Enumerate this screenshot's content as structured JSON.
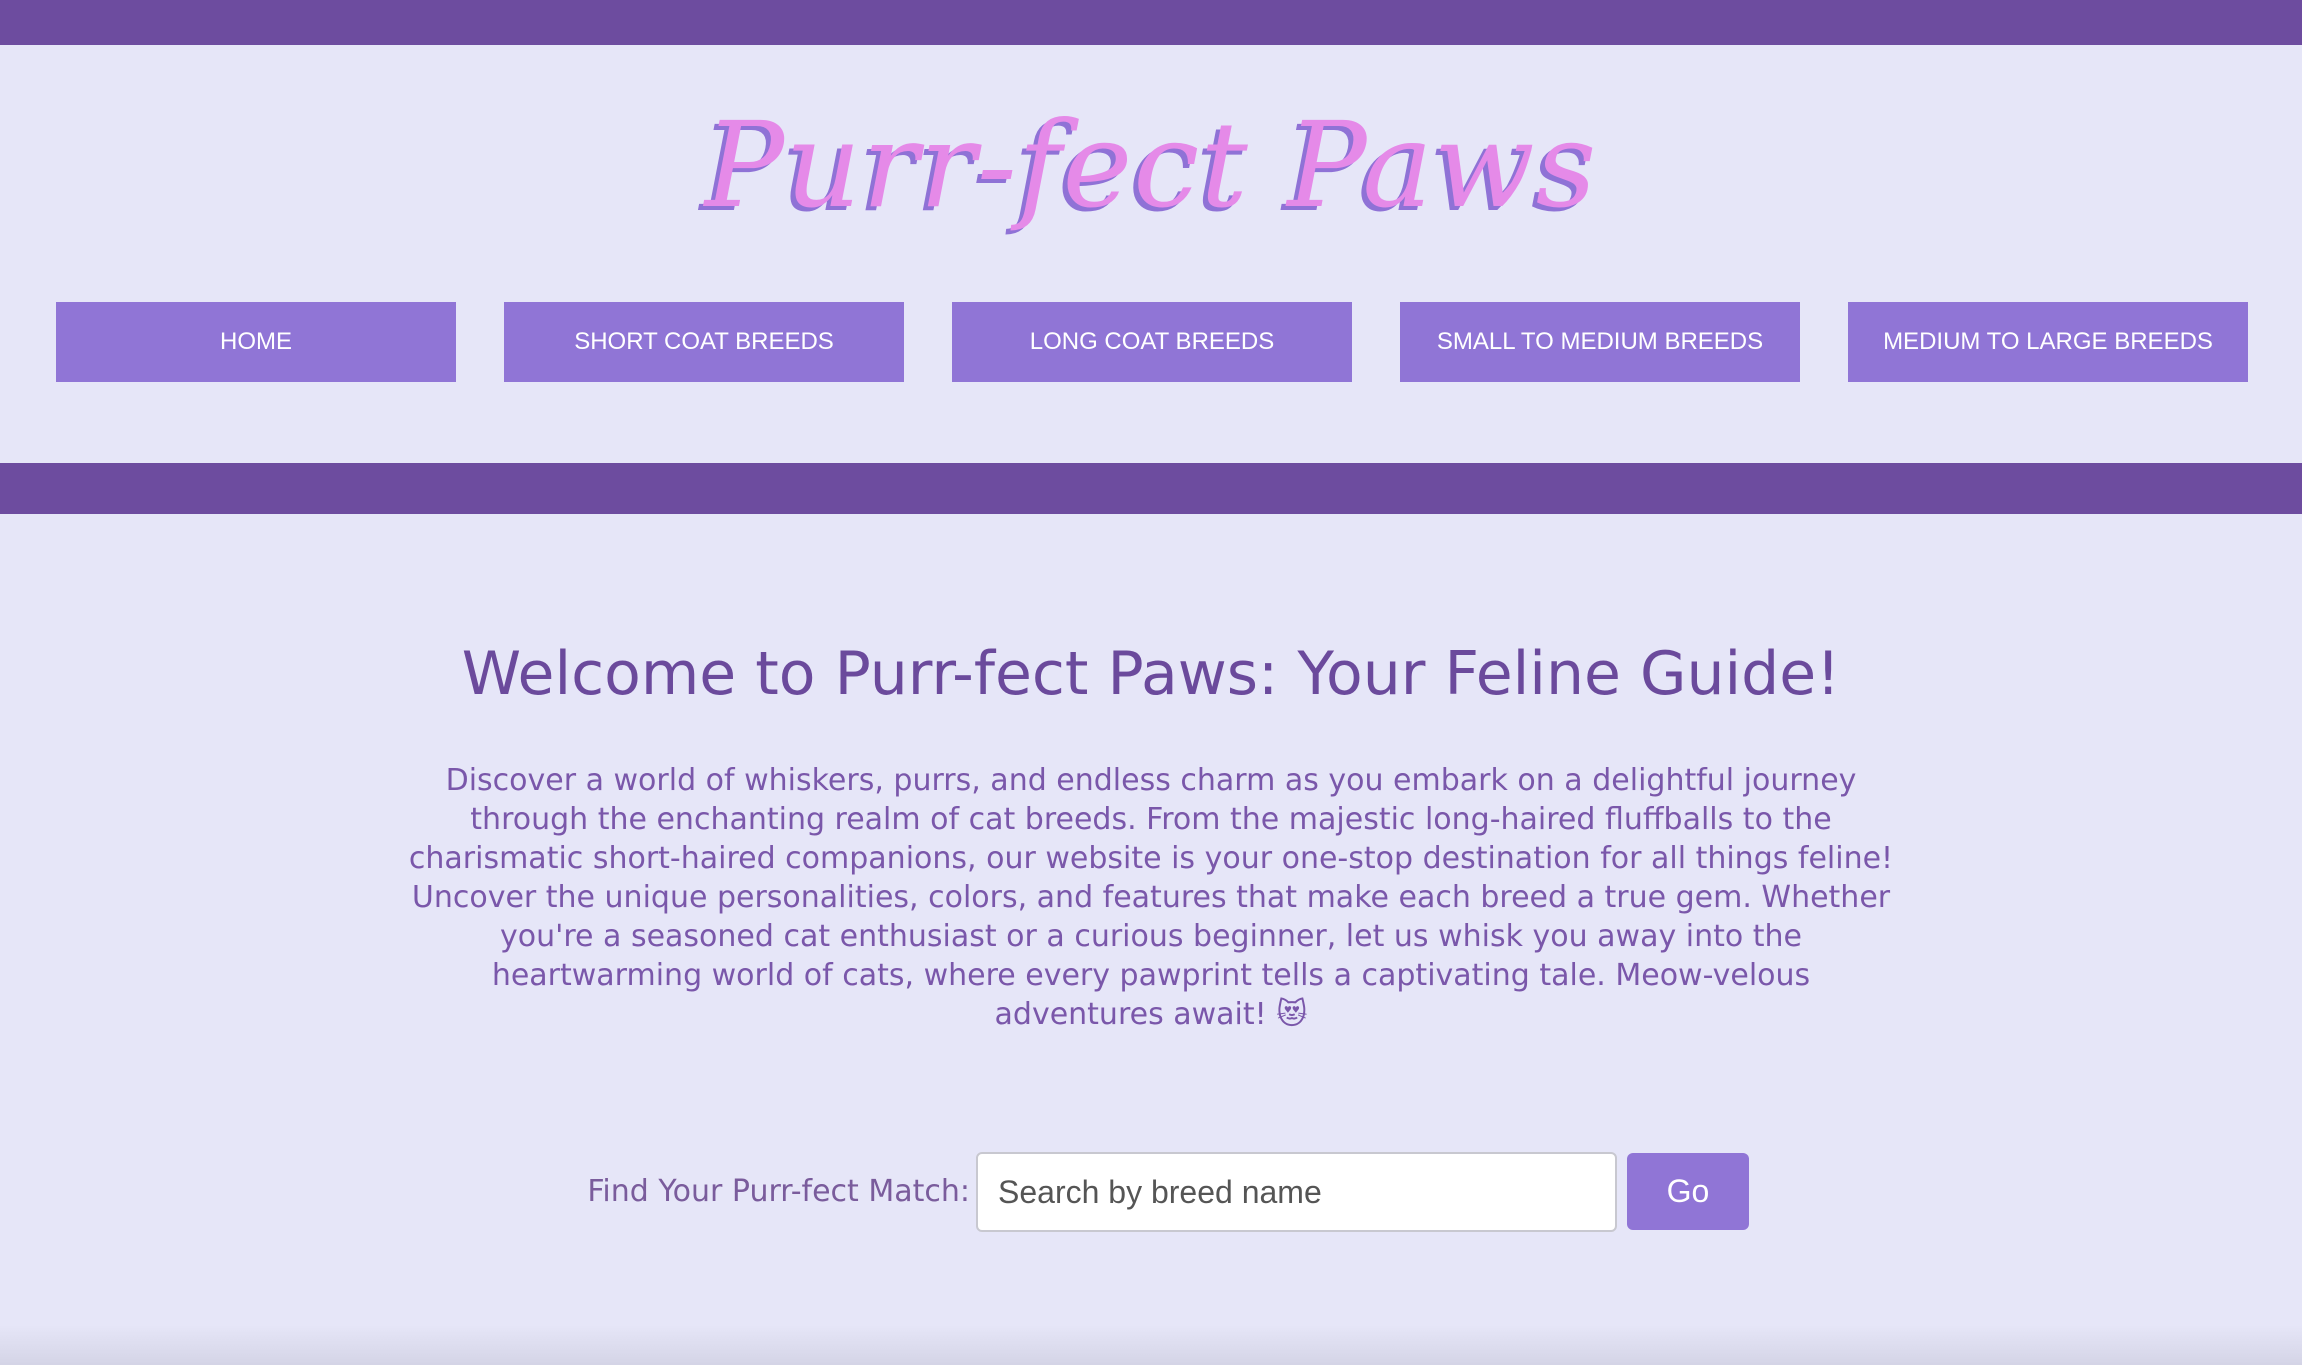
{
  "header": {
    "logo_text": "Purr-fect Paws"
  },
  "nav": {
    "items": [
      {
        "label": "HOME"
      },
      {
        "label": "SHORT COAT BREEDS"
      },
      {
        "label": "LONG COAT BREEDS"
      },
      {
        "label": "SMALL TO MEDIUM BREEDS"
      },
      {
        "label": "MEDIUM TO LARGE BREEDS"
      }
    ]
  },
  "main": {
    "title": "Welcome to Purr-fect Paws: Your Feline Guide!",
    "intro": "Discover a world of whiskers, purrs, and endless charm as you embark on a delightful journey through the enchanting realm of cat breeds. From the majestic long-haired fluffballs to the charismatic short-haired companions, our website is your one-stop destination for all things feline! Uncover the unique personalities, colors, and features that make each breed a true gem. Whether you're a seasoned cat enthusiast or a curious beginner, let us whisk you away into the heartwarming world of cats, where every pawprint tells a captivating tale. Meow-velous adventures await! 😻"
  },
  "search": {
    "label": "Find Your Purr-fect Match:",
    "placeholder": "Search by breed name",
    "value": "",
    "button_label": "Go"
  },
  "colors": {
    "background": "#e6e6f8",
    "bar": "#6d4c9f",
    "button": "#9075d6",
    "logo": "#e58ae8",
    "heading": "#6b4a9c"
  }
}
